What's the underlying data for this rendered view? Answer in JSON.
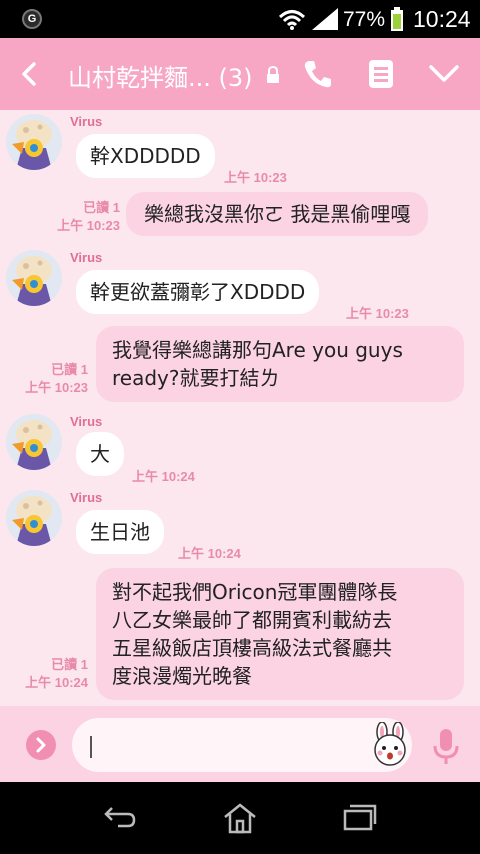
{
  "status_bar": {
    "battery_percent": "77%",
    "time": "10:24"
  },
  "header": {
    "title": "山村乾拌麵...",
    "member_count": "(3)"
  },
  "messages": [
    {
      "sender": "Virus",
      "text": "幹XDDDDD",
      "time": "上午 10:23"
    },
    {
      "text": "樂總我沒黑你ㄛ 我是黑偷哩嘎",
      "read": "已讀 1",
      "time": "上午 10:23"
    },
    {
      "sender": "Virus",
      "text": "幹更欲蓋彌彰了XDDDD",
      "time": "上午 10:23"
    },
    {
      "text_lines": [
        "我覺得樂總講那句Are you guys",
        "ready?就要打結ㄌ"
      ],
      "read": "已讀 1",
      "time": "上午 10:23"
    },
    {
      "sender": "Virus",
      "text": "大",
      "time": "上午 10:24"
    },
    {
      "sender": "Virus",
      "text": "生日池",
      "time": "上午 10:24"
    },
    {
      "text_lines": [
        "對不起我們Oricon冠軍團體隊長",
        "八乙女樂最帥了都開賓利載紡去",
        "五星級飯店頂樓高級法式餐廳共",
        "度浪漫燭光晚餐"
      ],
      "read": "已讀 1",
      "time": "上午 10:24"
    }
  ],
  "input": {
    "value": ""
  }
}
